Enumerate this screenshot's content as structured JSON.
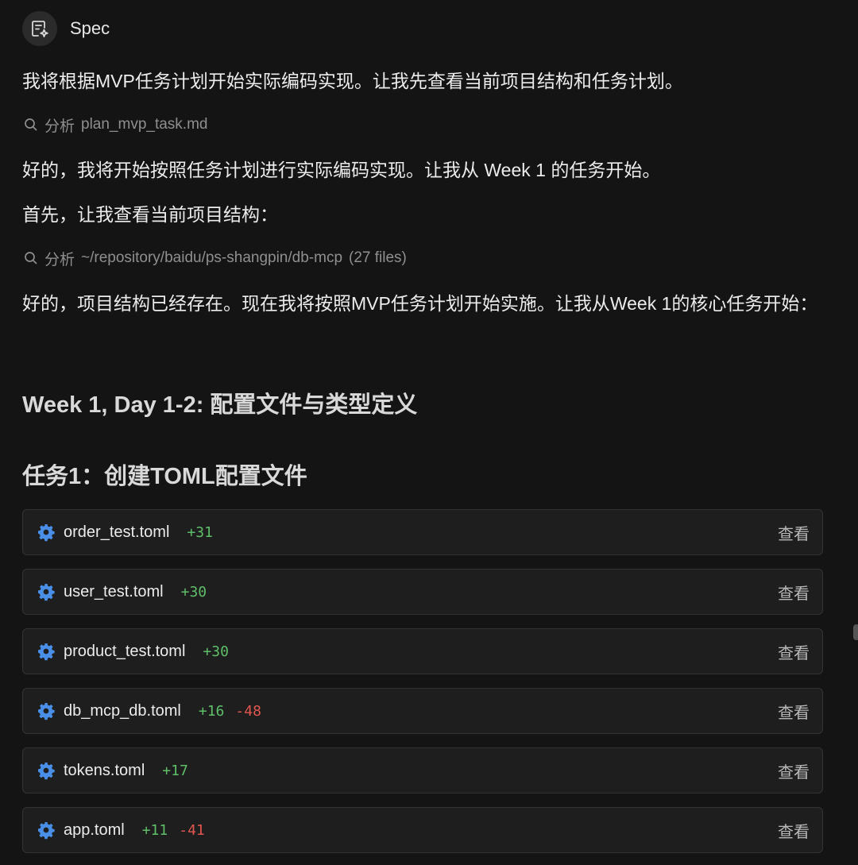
{
  "header": {
    "title": "Spec"
  },
  "messages": {
    "intro": "我将根据MVP任务计划开始实际编码实现。让我先查看当前项目结构和任务计划。",
    "tool1": {
      "verb": "分析",
      "target": "plan_mvp_task.md"
    },
    "p2": "好的，我将开始按照任务计划进行实际编码实现。让我从 Week 1 的任务开始。",
    "p3": "首先，让我查看当前项目结构：",
    "tool2": {
      "verb": "分析",
      "target": "~/repository/baidu/ps-shangpin/db-mcp",
      "count": "(27 files)"
    },
    "p4": "好的，项目结构已经存在。现在我将按照MVP任务计划开始实施。让我从Week 1的核心任务开始："
  },
  "headings": {
    "week": "Week 1, Day 1-2: 配置文件与类型定义",
    "task": "任务1：创建TOML配置文件"
  },
  "files": [
    {
      "name": "order_test.toml",
      "added": "+31",
      "removed": "",
      "view": "查看"
    },
    {
      "name": "user_test.toml",
      "added": "+30",
      "removed": "",
      "view": "查看"
    },
    {
      "name": "product_test.toml",
      "added": "+30",
      "removed": "",
      "view": "查看"
    },
    {
      "name": "db_mcp_db.toml",
      "added": "+16",
      "removed": "-48",
      "view": "查看"
    },
    {
      "name": "tokens.toml",
      "added": "+17",
      "removed": "",
      "view": "查看"
    },
    {
      "name": "app.toml",
      "added": "+11",
      "removed": "-41",
      "view": "查看"
    }
  ],
  "colors": {
    "background": "#141414",
    "added": "#5fbf69",
    "removed": "#e0564f",
    "gear_icon": "#4a8fe7"
  },
  "icons": {
    "header": "spec-document-icon",
    "tool": "search-icon",
    "file": "gear-icon"
  }
}
